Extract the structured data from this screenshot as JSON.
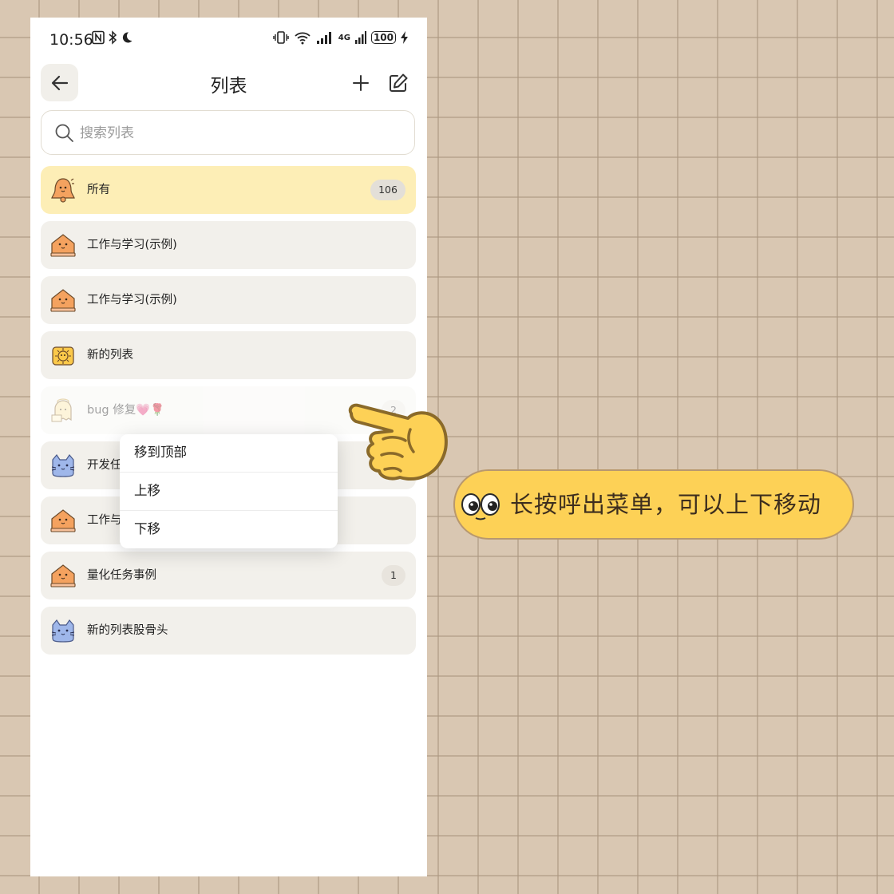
{
  "status_bar": {
    "time": "10:56",
    "network": "4G",
    "battery": "100"
  },
  "header": {
    "title": "列表"
  },
  "search": {
    "placeholder": "搜索列表"
  },
  "lists": [
    {
      "label": "所有",
      "count": "106",
      "icon": "bell-mascot-icon",
      "state": "active"
    },
    {
      "label": "工作与学习(示例)",
      "count": "",
      "icon": "house-mascot-icon",
      "state": "normal"
    },
    {
      "label": "工作与学习(示例)",
      "count": "",
      "icon": "house-mascot-icon",
      "state": "normal"
    },
    {
      "label": "新的列表",
      "count": "",
      "icon": "sun-mascot-icon",
      "state": "normal"
    },
    {
      "label": "bug 修复💗🌹",
      "count": "2",
      "icon": "ghost-mascot-icon",
      "state": "selected-faded"
    },
    {
      "label": "开发任",
      "count": "",
      "icon": "cat-mascot-icon",
      "state": "normal"
    },
    {
      "label": "工作与",
      "count": "",
      "icon": "house-mascot-icon",
      "state": "normal"
    },
    {
      "label": "量化任务事例",
      "count": "1",
      "icon": "house-mascot-icon",
      "state": "normal"
    },
    {
      "label": "新的列表股骨头",
      "count": "",
      "icon": "cat-mascot-icon",
      "state": "normal"
    }
  ],
  "context_menu": {
    "items": [
      "移到顶部",
      "上移",
      "下移"
    ]
  },
  "callout": {
    "text": "长按呼出菜单，可以上下移动"
  },
  "colors": {
    "background": "#d9c7b2",
    "active_row": "#fdeeb6",
    "row": "#f2f0eb",
    "callout": "#fdd156",
    "mascot_orange": "#f4a25f",
    "mascot_blue": "#9fb7ea"
  }
}
